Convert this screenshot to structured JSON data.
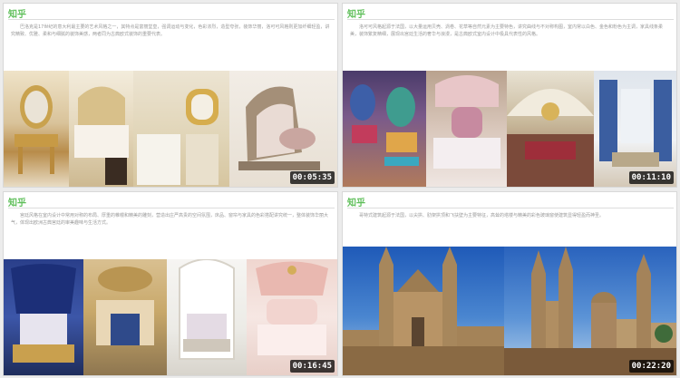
{
  "tiles": [
    {
      "logo": "知乎",
      "text": "巴洛克是17世纪的意大利最主要的艺术风格之一，其特点是富丽堂皇，强调运动与变化，色彩浓烈，造型夸张，装饰华丽，洛可可风格则更加纤细轻盈，讲究精致、优雅、柔和与细腻的装饰美感，两者同为古典欧式装饰的重要代表。",
      "timestamp": "00:05:35",
      "photos": [
        "gilded-vanity-photo",
        "carved-bedroom-photo",
        "ornate-mirror-photo",
        "classic-sofa-photo"
      ]
    },
    {
      "logo": "知乎",
      "text": "洛可可风格起源于法国，以大量运用贝壳、涡卷、花草等自然元素为主要特色，讲究曲线与不对称构图，室内常以白色、金色和粉色为主调，家具线条柔美，装饰繁复精细，展现出宫廷生活的奢华与浪漫，是古典欧式室内设计中极具代表性的风格。",
      "timestamp": "00:11:10",
      "photos": [
        "painted-chairs-photo",
        "canopy-bed-photo",
        "palace-hall-photo",
        "blue-curtain-room-photo"
      ]
    },
    {
      "logo": "知乎",
      "text": "宫廷风格在室内设计中常用对称的布局、厚重的帷幔和精美的雕刻，营造出庄严高贵的空间氛围，床品、窗帘与家具的色彩搭配讲究统一，整体装饰华丽大气，体现出欧洲古典宫廷的审美趣味与生活方式。",
      "timestamp": "00:16:45",
      "photos": [
        "royal-blue-bedroom-photo",
        "gilded-ceiling-photo",
        "white-arch-bedroom-photo",
        "pink-canopy-bedroom-photo"
      ]
    },
    {
      "logo": "知乎",
      "text": "哥特式建筑起源于法国，以尖拱、肋架拱顶和飞扶壁为主要特征，高耸的塔楼与精美的彩色玻璃窗使建筑显得轻盈而神圣。",
      "timestamp": "00:22:20",
      "photos": [
        "cathedral-front-photo",
        "cathedral-skyline-photo"
      ]
    }
  ],
  "colors": {
    "logo": "#5fbf5a",
    "text": "#9a9a9a",
    "timestamp_bg": "#000000",
    "timestamp_fg": "#ffffff"
  }
}
